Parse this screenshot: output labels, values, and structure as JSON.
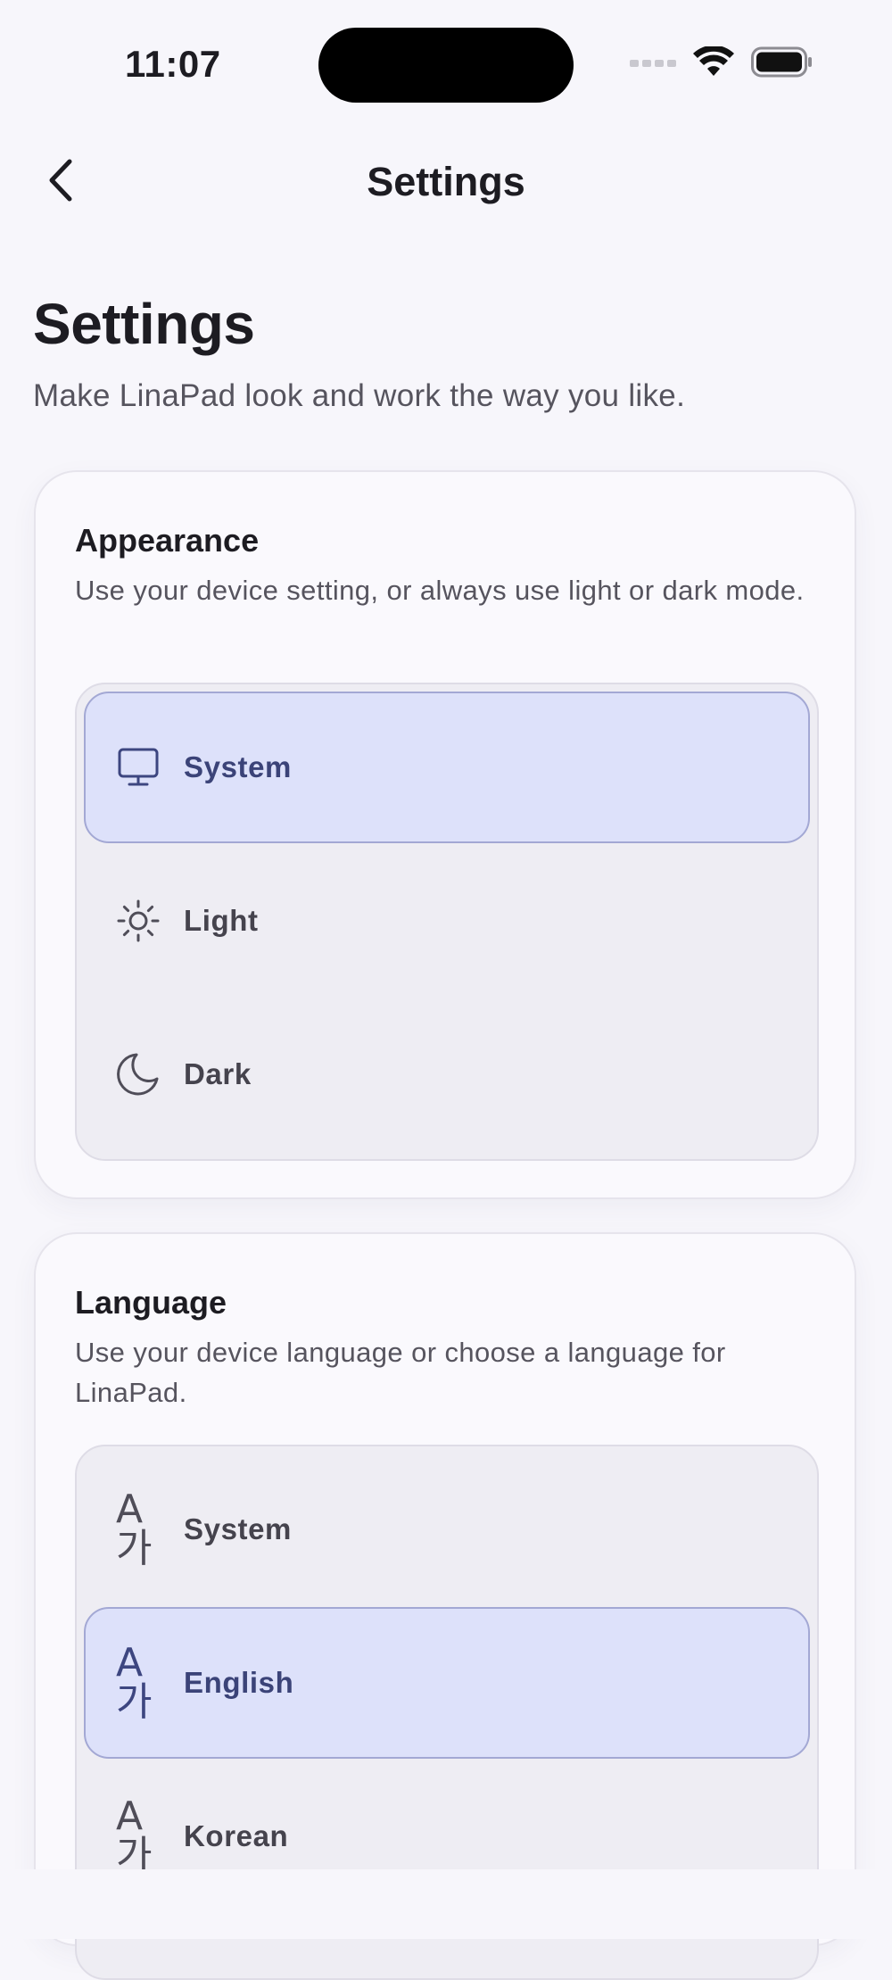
{
  "status_bar": {
    "time": "11:07"
  },
  "nav": {
    "title": "Settings"
  },
  "page": {
    "title": "Settings",
    "subtitle": "Make LinaPad look and work the way you like."
  },
  "appearance": {
    "title": "Appearance",
    "description": "Use your device setting, or always use light or dark mode.",
    "options": [
      {
        "label": "System",
        "icon": "monitor-icon",
        "selected": true
      },
      {
        "label": "Light",
        "icon": "sun-icon",
        "selected": false
      },
      {
        "label": "Dark",
        "icon": "moon-icon",
        "selected": false
      }
    ]
  },
  "language": {
    "title": "Language",
    "description": "Use your device language or choose a language for LinaPad.",
    "options": [
      {
        "label": "System",
        "icon": "language-icon",
        "selected": false
      },
      {
        "label": "English",
        "icon": "language-icon",
        "selected": true
      },
      {
        "label": "Korean",
        "icon": "language-icon",
        "selected": false
      }
    ]
  },
  "colors": {
    "background": "#f7f6fb",
    "selected_fill": "#dde1fa",
    "selected_border": "#a3a8d4",
    "selected_text": "#3b4378",
    "group_fill": "#eeedf3"
  }
}
